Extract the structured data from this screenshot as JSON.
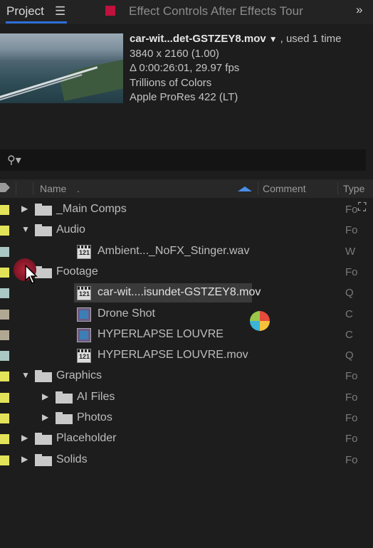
{
  "tabs": {
    "project": "Project",
    "menu_icon": "hamburger-menu-icon",
    "effect_controls": "Effect Controls After Effects Tour",
    "swatch_color": "#c0123c",
    "more_icon": "double-chevron-right-icon"
  },
  "footage_info": {
    "filename": "car-wit...det-GSTZEY8.mov",
    "used": ", used 1 time",
    "resolution": "3840 x 2160 (1.00)",
    "duration": "Δ 0:00:26:01, 29.97 fps",
    "colors": "Trillions of Colors",
    "codec": "Apple ProRes 422 (LT)"
  },
  "search": {
    "icon": "search-icon"
  },
  "columns": {
    "name": "Name",
    "dot": ".",
    "comment": "Comment",
    "type": "Type"
  },
  "rows": [
    {
      "name": "_Main Comps",
      "kind": "folder",
      "indent": 0,
      "expanded": false,
      "label_color": "#e3e35a",
      "type": "Fo"
    },
    {
      "name": "Audio",
      "kind": "folder",
      "indent": 0,
      "expanded": true,
      "label_color": "#e3e35a",
      "type": "Fo"
    },
    {
      "name": "Ambient..._NoFX_Stinger.wav",
      "kind": "file",
      "indent": 1,
      "label_color": "#a9c7c4",
      "type": "W"
    },
    {
      "name": "Footage",
      "kind": "folder",
      "indent": 0,
      "expanded": true,
      "label_color": "#e3e35a",
      "type": "Fo"
    },
    {
      "name": "car-wit....isundet-GSTZEY8.mov",
      "kind": "file",
      "indent": 1,
      "label_color": "#a9c7c4",
      "type": "Q",
      "selected": true
    },
    {
      "name": "Drone Shot",
      "kind": "comp",
      "indent": 1,
      "label_color": "#b1a894",
      "type": "C"
    },
    {
      "name": "HYPERLAPSE LOUVRE",
      "kind": "comp",
      "indent": 1,
      "label_color": "#b1a894",
      "type": "C"
    },
    {
      "name": "HYPERLAPSE LOUVRE.mov",
      "kind": "file",
      "indent": 1,
      "label_color": "#a9c7c4",
      "type": "Q"
    },
    {
      "name": "Graphics",
      "kind": "folder",
      "indent": 0,
      "expanded": true,
      "label_color": "#e3e35a",
      "type": "Fo"
    },
    {
      "name": "AI Files",
      "kind": "folder",
      "indent": 1,
      "expanded": false,
      "label_color": "#e3e35a",
      "type": "Fo"
    },
    {
      "name": "Photos",
      "kind": "folder",
      "indent": 1,
      "expanded": false,
      "label_color": "#e3e35a",
      "type": "Fo"
    },
    {
      "name": "Placeholder",
      "kind": "folder",
      "indent": 0,
      "expanded": false,
      "label_color": "#e3e35a",
      "type": "Fo"
    },
    {
      "name": "Solids",
      "kind": "folder",
      "indent": 0,
      "expanded": false,
      "label_color": "#e3e35a",
      "type": "Fo"
    }
  ],
  "flowchart_icon": "flowchart-icon"
}
